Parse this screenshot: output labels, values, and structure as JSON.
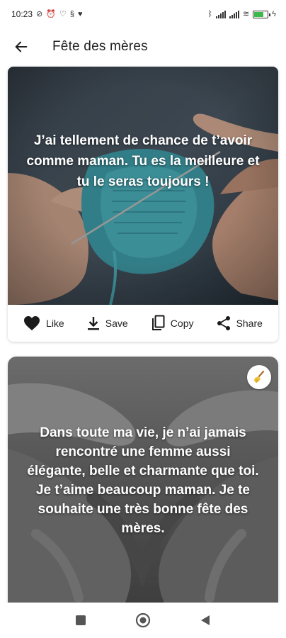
{
  "status_bar": {
    "time": "10:23",
    "battery_color": "#3cb94a"
  },
  "app_bar": {
    "back_icon": "arrow-left-icon",
    "title": "Fête des mères"
  },
  "cards": [
    {
      "quote": "J’ai tellement de chance de t’avoir comme maman. Tu es la meilleure et tu le seras toujours !",
      "image": "hands-knitting-teal-wool",
      "actions": [
        {
          "icon": "heart-icon",
          "label": "Like"
        },
        {
          "icon": "download-icon",
          "label": "Save"
        },
        {
          "icon": "copy-icon",
          "label": "Copy"
        },
        {
          "icon": "share-icon",
          "label": "Share"
        }
      ]
    },
    {
      "quote": "Dans toute ma vie, je n’ai jamais rencontré une femme aussi élégante, belle et charmante que toi. Je t’aime beaucoup maman. Je te souhaite une très bonne fête des mères.",
      "image": "hands-heart-monochrome",
      "badge_icon": "broom-icon"
    }
  ],
  "nav_bar": {
    "items": [
      "recents-square-icon",
      "home-circle-icon",
      "back-triangle-icon"
    ]
  }
}
